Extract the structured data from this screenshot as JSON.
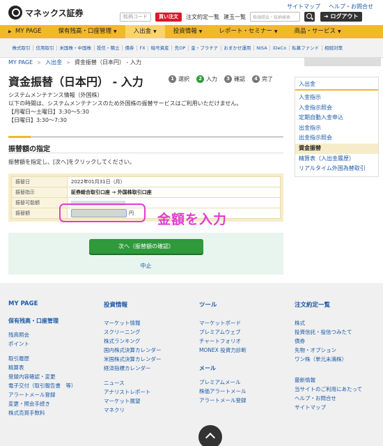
{
  "header": {
    "logo_text": "マネックス証券",
    "top_links": [
      "サイトマップ",
      "ヘルプ・お問合せ"
    ],
    "code_btn": "銘柄コード",
    "buy_btn": "買い注文",
    "order_list": "注文約定一覧",
    "positions": "建玉一覧",
    "search_placeholder": "株価照会・銘柄検索",
    "logout": "ログアウト"
  },
  "nav": {
    "items": [
      "MY PAGE",
      "保有残高・口座管理",
      "入出金",
      "投資情報",
      "レポート・セミナー",
      "商品・サービス"
    ]
  },
  "subnav": {
    "items": [
      "株式取引",
      "信用取引",
      "米国株・中国株",
      "投信・積立",
      "債券",
      "FX",
      "暗号資産",
      "先OP",
      "金・プラチナ",
      "おまかせ運用",
      "NISA",
      "iDeCo",
      "私募ファンド",
      "相続対策"
    ]
  },
  "breadcrumb": [
    "MY PAGE",
    "入出金",
    "資金振替（日本円） - 入力"
  ],
  "page_title": "資金振替（日本円） - 入力",
  "steps": [
    {
      "num": "1",
      "label": "選択"
    },
    {
      "num": "2",
      "label": "入力"
    },
    {
      "num": "3",
      "label": "確認"
    },
    {
      "num": "4",
      "label": "完了"
    }
  ],
  "notice": {
    "line1": "システムメンテナンス情報（外国株）",
    "line2": "以下の時間は、システムメンテナンスのため外国株の振替サービスはご利用いただけません。",
    "line3": "【月曜日～土曜日】3:30～5:30",
    "line4": "【日曜日】3:30～7:30"
  },
  "section_title": "振替額の指定",
  "instruction": "振替額を指定し、[次へ]をクリックしてください。",
  "form": {
    "date_label": "振替日",
    "date_value": "2022年01月31日（月）",
    "direction_label": "振替指示",
    "direction_value": "証券総合取引口座 → 外国株取引口座",
    "available_label": "振替可能額",
    "amount_label": "振替額",
    "amount_unit": "円"
  },
  "annotation": "金額を入力",
  "next_button": "次へ（振替額の確認）",
  "cancel_link": "中止",
  "side_menu": {
    "head": "入出金",
    "items": [
      "入金指示",
      "入金指示照会",
      "定期自動入金申込",
      "出金指示",
      "出金指示照会",
      "資金振替",
      "精算表（入出金履歴）",
      "リアルタイム外国為替取引"
    ]
  },
  "footer": {
    "col1": {
      "head": "MY PAGE",
      "sub": "保有残高・口座管理",
      "group1": [
        "残高照会",
        "ポイント"
      ],
      "group2": [
        "取引履歴",
        "精算表",
        "登録内容確認・変更",
        "電子交付（取引報告書　等）",
        "アラートメール登録",
        "変更・照会手続き",
        "株式売買手数料"
      ]
    },
    "col2": {
      "head": "投資情報",
      "group1": [
        "マーケット情報",
        "スクリーニング",
        "株式ランキング",
        "国内株式決算カレンダー",
        "米国株式決算カレンダー",
        "経済指標カレンダー"
      ],
      "group2": [
        "ニュース",
        "アナリストレポート",
        "マーケット展望",
        "マネクリ"
      ]
    },
    "col3": {
      "head": "ツール",
      "group1": [
        "マーケットボード",
        "プレミアムウェブ",
        "チャートフォリオ",
        "MONEX 投資力診断"
      ],
      "sub": "メール",
      "group2": [
        "プレミアムメール",
        "株価アラートメール",
        "アラートメール登録"
      ]
    },
    "col4": {
      "head": "注文約定一覧",
      "group1": [
        "株式",
        "投資信託・投信つみたて",
        "債券",
        "先物・オプション",
        "ワン株（単元未満株）"
      ],
      "group2": [
        "最新情報",
        "当サイトのご利用にあたって",
        "ヘルプ・お問合せ",
        "サイトマップ"
      ]
    }
  }
}
